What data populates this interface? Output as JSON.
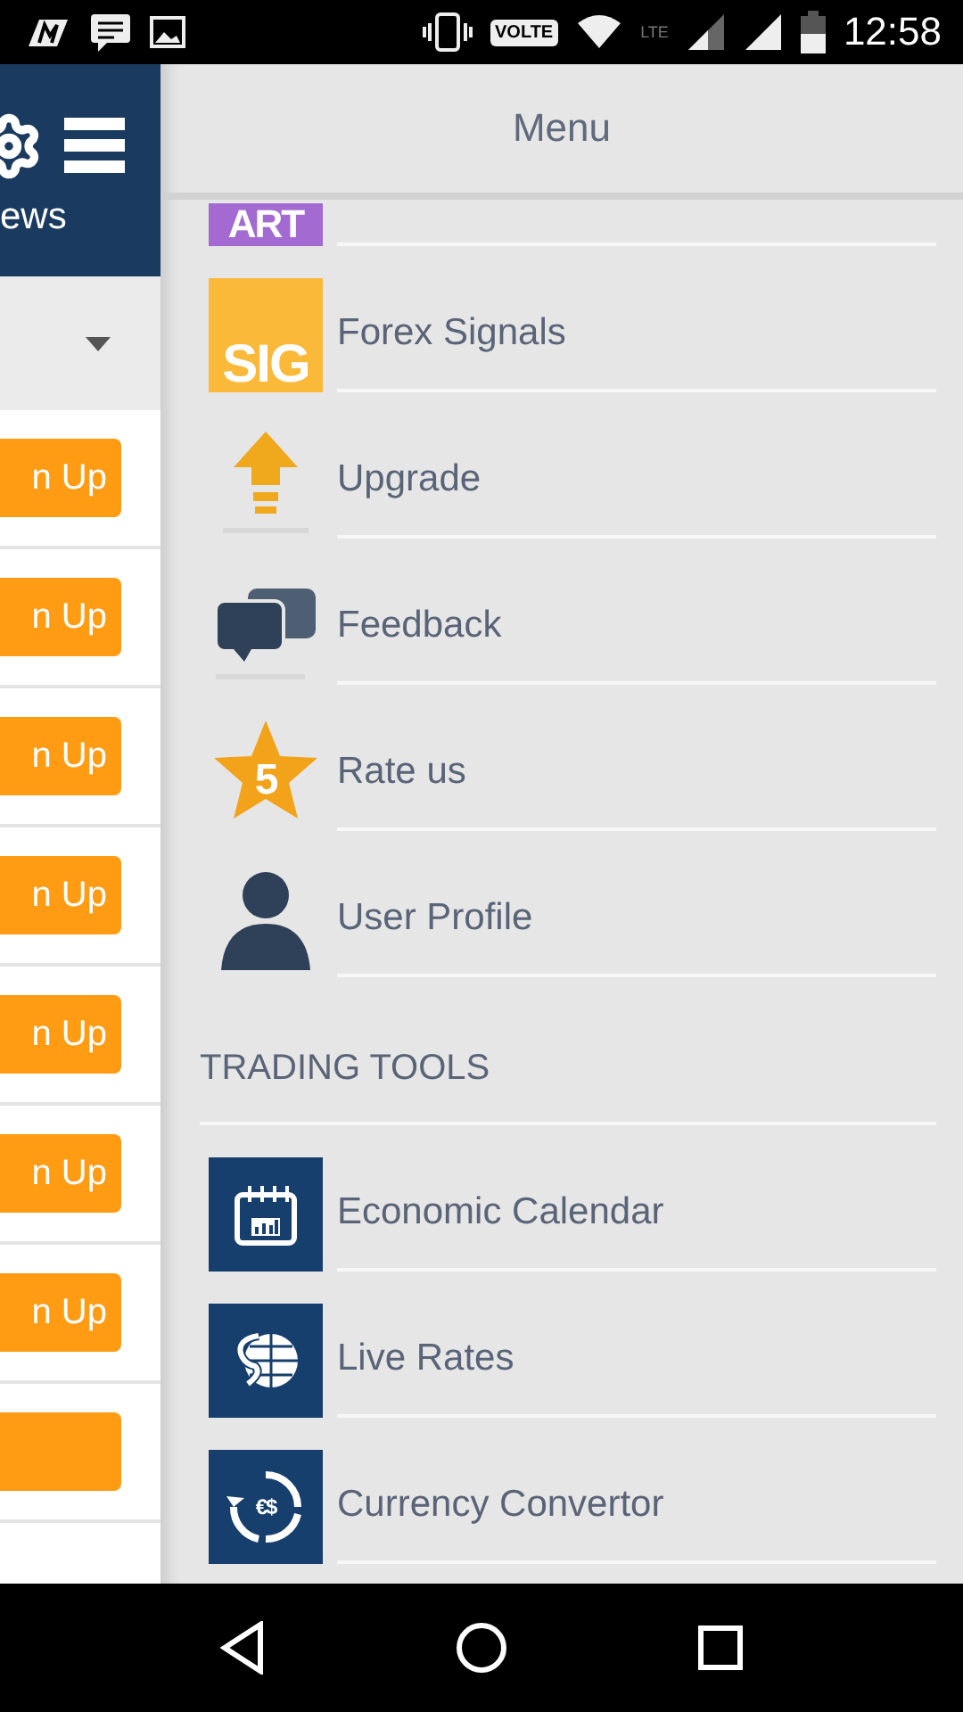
{
  "status_bar": {
    "network": "VOLTE",
    "lte": "LTE",
    "time": "12:58"
  },
  "left_pane": {
    "header_text": "ews",
    "buttons": [
      {
        "label": "n Up"
      },
      {
        "label": "n Up"
      },
      {
        "label": "n Up"
      },
      {
        "label": "n Up"
      },
      {
        "label": "n Up"
      },
      {
        "label": "n Up"
      },
      {
        "label": "n Up"
      },
      {
        "kind": "cut"
      }
    ]
  },
  "menu": {
    "title": "Menu",
    "items": [
      {
        "kind": "art",
        "icon_text": "ART"
      },
      {
        "kind": "sig",
        "icon_text": "SIG",
        "label": "Forex Signals"
      },
      {
        "kind": "upgrade",
        "label": "Upgrade"
      },
      {
        "kind": "feedback",
        "label": "Feedback"
      },
      {
        "kind": "rate",
        "icon_text": "5",
        "label": "Rate us"
      },
      {
        "kind": "profile",
        "label": "User Profile"
      }
    ],
    "section": "TRADING TOOLS",
    "tools": [
      {
        "kind": "calendar",
        "label": "Economic Calendar"
      },
      {
        "kind": "globe",
        "label": "Live Rates"
      },
      {
        "kind": "convert",
        "icon_text": "€$",
        "label": "Currency Convertor"
      }
    ]
  }
}
